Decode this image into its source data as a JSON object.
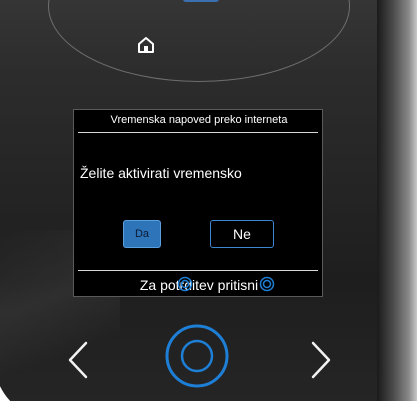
{
  "screen": {
    "title": "Vremenska napoved preko interneta",
    "question": "Želite aktivirati vremensko",
    "yes_label": "Da",
    "no_label": "Ne",
    "footer_text": "Za potrditev pritisni"
  },
  "icons": {
    "home": "home-icon",
    "confirm": "ring-icon",
    "left": "chevron-left-icon",
    "right": "chevron-right-icon",
    "ok": "ok-ring-icon"
  },
  "colors": {
    "accent": "#2d74b9",
    "ring": "#1e7fd6",
    "screen_bg": "#000000",
    "panel": "#2c2c2c"
  }
}
